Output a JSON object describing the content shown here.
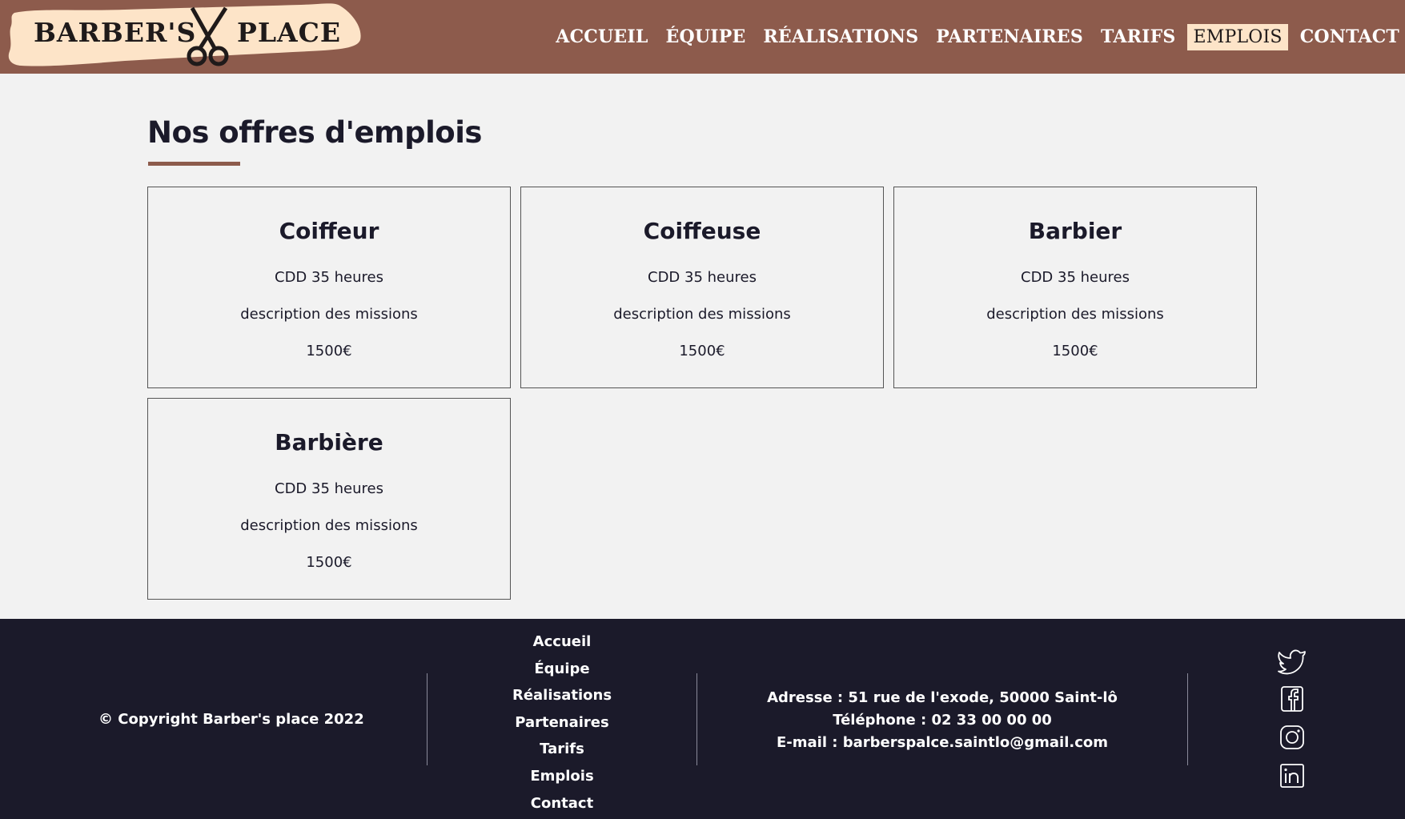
{
  "header": {
    "logo": {
      "left": "BARBER'S",
      "right": "PLACE"
    },
    "nav": [
      {
        "label": "ACCUEIL",
        "active": false
      },
      {
        "label": "ÉQUIPE",
        "active": false
      },
      {
        "label": "RÉALISATIONS",
        "active": false
      },
      {
        "label": "PARTENAIRES",
        "active": false
      },
      {
        "label": "TARIFS",
        "active": false
      },
      {
        "label": "EMPLOIS",
        "active": true
      },
      {
        "label": "CONTACT",
        "active": false
      }
    ]
  },
  "main": {
    "title": "Nos offres d'emplois",
    "jobs": [
      {
        "title": "Coiffeur",
        "contract": "CDD 35 heures",
        "description": "description des missions",
        "salary": "1500€"
      },
      {
        "title": "Coiffeuse",
        "contract": "CDD 35 heures",
        "description": "description des missions",
        "salary": "1500€"
      },
      {
        "title": "Barbier",
        "contract": "CDD 35 heures",
        "description": "description des missions",
        "salary": "1500€"
      },
      {
        "title": "Barbière",
        "contract": "CDD 35 heures",
        "description": "description des missions",
        "salary": "1500€"
      }
    ]
  },
  "footer": {
    "copyright": "© Copyright Barber's place 2022",
    "links": [
      "Accueil",
      "Équipe",
      "Réalisations",
      "Partenaires",
      "Tarifs",
      "Emplois",
      "Contact"
    ],
    "contact": {
      "address": "Adresse : 51 rue de l'exode, 50000 Saint-lô",
      "phone": "Téléphone : 02 33 00 00 00",
      "email": "E-mail : barberspalce.saintlo@gmail.com"
    },
    "socials": [
      "twitter-icon",
      "facebook-icon",
      "instagram-icon",
      "linkedin-icon"
    ]
  },
  "colors": {
    "header": "#8d5b4c",
    "footer": "#1b1a2a",
    "background": "#f2f2f2",
    "logo_banner": "#fde4c8"
  }
}
